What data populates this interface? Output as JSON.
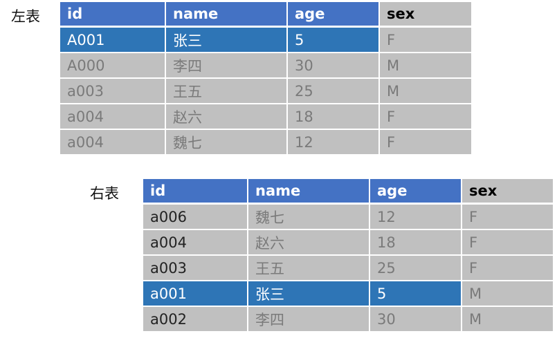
{
  "left_table": {
    "caption": "左表",
    "headers": [
      "id",
      "name",
      "age",
      "sex"
    ],
    "rows": [
      [
        "A001",
        "张三",
        "5",
        "F"
      ],
      [
        "A000",
        "李四",
        "30",
        "M"
      ],
      [
        "a003",
        "王五",
        "25",
        "M"
      ],
      [
        "a004",
        "赵六",
        "18",
        "F"
      ],
      [
        "a004",
        "魏七",
        "12",
        "F"
      ]
    ]
  },
  "right_table": {
    "caption": "右表",
    "headers": [
      "id",
      "name",
      "age",
      "sex"
    ],
    "rows": [
      [
        "a006",
        "魏七",
        "12",
        "F"
      ],
      [
        "a004",
        "赵六",
        "18",
        "F"
      ],
      [
        "a003",
        "王五",
        "25",
        "F"
      ],
      [
        "a001",
        "张三",
        "5",
        "M"
      ],
      [
        "a002",
        "李四",
        "30",
        "M"
      ]
    ]
  },
  "colors": {
    "header_blue": "#4472c4",
    "highlight_blue": "#2e75b6",
    "cell_gray": "#c0c0c0"
  }
}
